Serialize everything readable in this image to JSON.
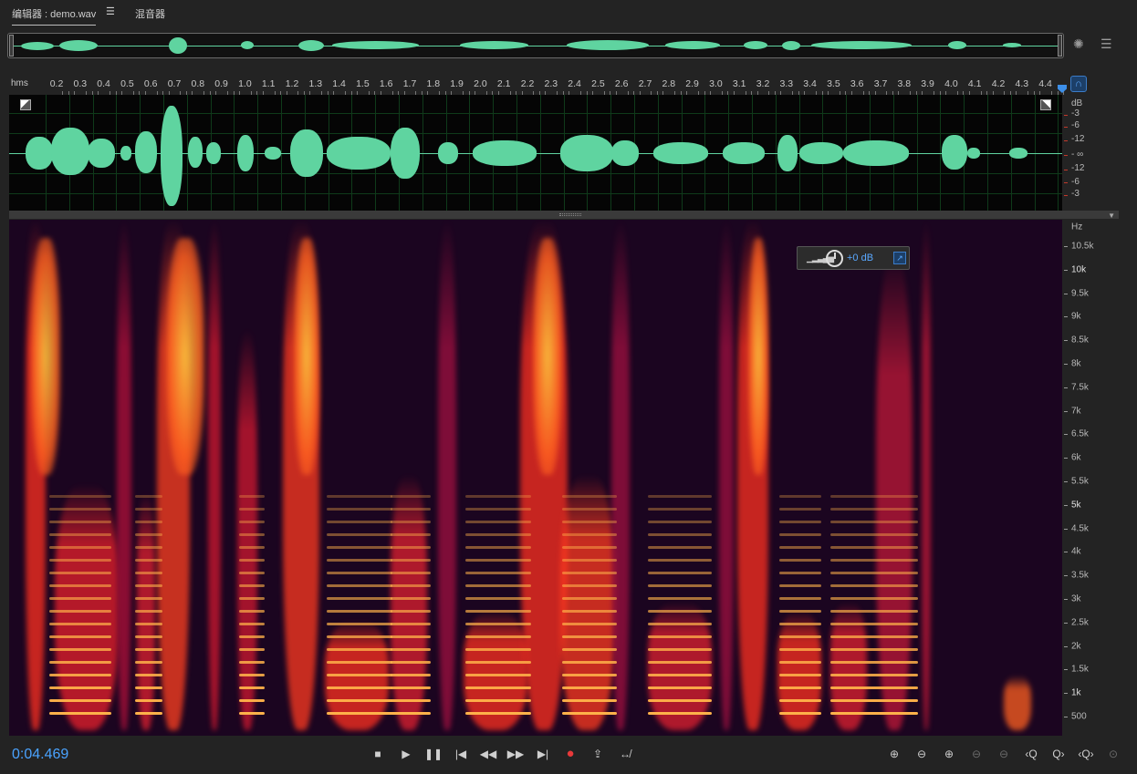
{
  "tabs": [
    {
      "label": "编辑器 : demo.wav",
      "active": true
    },
    {
      "label": "混音器",
      "active": false
    }
  ],
  "tab_menu_icon": "☰",
  "ruler": {
    "units_label": "hms",
    "ticks": [
      "0.2",
      "0.3",
      "0.4",
      "0.5",
      "0.6",
      "0.7",
      "0.8",
      "0.9",
      "1.0",
      "1.1",
      "1.2",
      "1.3",
      "1.4",
      "1.5",
      "1.6",
      "1.7",
      "1.8",
      "1.9",
      "2.0",
      "2.1",
      "2.2",
      "2.3",
      "2.4",
      "2.5",
      "2.6",
      "2.7",
      "2.8",
      "2.9",
      "3.0",
      "3.1",
      "3.2",
      "3.3",
      "3.4",
      "3.5",
      "3.6",
      "3.7",
      "3.8",
      "3.9",
      "4.0",
      "4.1",
      "4.2",
      "4.3",
      "4.4"
    ]
  },
  "db_scale": {
    "unit": "dB",
    "labels": [
      "-3",
      "-6",
      "-12",
      "- ∞",
      "-12",
      "-6",
      "-3"
    ]
  },
  "hz_scale": {
    "unit": "Hz",
    "labels": [
      "10.5k",
      "10k",
      "9.5k",
      "9k",
      "8.5k",
      "8k",
      "7.5k",
      "7k",
      "6.5k",
      "6k",
      "5.5k",
      "5k",
      "4.5k",
      "4k",
      "3.5k",
      "3k",
      "2.5k",
      "2k",
      "1.5k",
      "1k",
      "500"
    ]
  },
  "hud": {
    "gain_value": "+0 dB"
  },
  "transport": {
    "current_time": "0:04.469",
    "buttons": [
      {
        "name": "stop-button",
        "glyph": "■"
      },
      {
        "name": "play-button",
        "glyph": "▶"
      },
      {
        "name": "pause-button",
        "glyph": "❚❚"
      },
      {
        "name": "move-to-previous-button",
        "glyph": "|◀"
      },
      {
        "name": "rewind-button",
        "glyph": "◀◀"
      },
      {
        "name": "fast-forward-button",
        "glyph": "▶▶"
      },
      {
        "name": "move-to-next-button",
        "glyph": "▶|"
      },
      {
        "name": "record-button",
        "glyph": "●"
      },
      {
        "name": "playback-loop-button",
        "glyph": "⇪"
      },
      {
        "name": "skip-selection-button",
        "glyph": "↮"
      }
    ],
    "zoom_buttons": [
      {
        "name": "zoom-in-amplitude-button",
        "glyph": "⊕",
        "dim": false
      },
      {
        "name": "zoom-out-amplitude-button",
        "glyph": "⊖",
        "dim": false
      },
      {
        "name": "zoom-in-time-button",
        "glyph": "⊕",
        "dim": false
      },
      {
        "name": "zoom-out-time-button",
        "glyph": "⊖",
        "dim": true
      },
      {
        "name": "zoom-out-full-button",
        "glyph": "⊖",
        "dim": true
      },
      {
        "name": "zoom-in-at-start-button",
        "glyph": "‹Q",
        "dim": false
      },
      {
        "name": "zoom-in-at-end-button",
        "glyph": "Q›",
        "dim": false
      },
      {
        "name": "zoom-to-selection-button",
        "glyph": "‹Q›",
        "dim": false
      },
      {
        "name": "zoom-reset-button",
        "glyph": "⊙",
        "dim": true
      }
    ]
  },
  "colors": {
    "waveform": "#5fd4a0",
    "time_display": "#4aa3ff",
    "record": "#e8393a"
  }
}
